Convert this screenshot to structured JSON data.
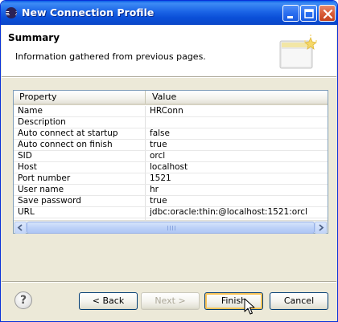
{
  "window": {
    "title": "New Connection Profile"
  },
  "header": {
    "title": "Summary",
    "description": "Information gathered from previous pages."
  },
  "table": {
    "columns": [
      "Property",
      "Value"
    ],
    "rows": [
      {
        "property": "Name",
        "value": "HRConn"
      },
      {
        "property": "Description",
        "value": ""
      },
      {
        "property": "Auto connect at startup",
        "value": "false"
      },
      {
        "property": "Auto connect on finish",
        "value": "true"
      },
      {
        "property": "SID",
        "value": "orcl"
      },
      {
        "property": "Host",
        "value": "localhost"
      },
      {
        "property": "Port number",
        "value": "1521"
      },
      {
        "property": "User name",
        "value": "hr"
      },
      {
        "property": "Save password",
        "value": "true"
      },
      {
        "property": "URL",
        "value": "jdbc:oracle:thin:@localhost:1521:orcl"
      }
    ]
  },
  "buttons": {
    "help": "?",
    "back": "< Back",
    "next": "Next >",
    "finish": "Finish",
    "cancel": "Cancel"
  },
  "icons": {
    "title_icon": "eclipse-icon",
    "wizard_icon": "wizard-banner-icon",
    "help_icon": "help-icon",
    "cursor": "mouse-pointer-icon"
  },
  "colors": {
    "titlebar": "#0a4fd8",
    "dialog_bg": "#ece9d8",
    "button_border": "#003c74",
    "finish_focus": "#f9c45a",
    "disabled_text": "#aca899"
  }
}
